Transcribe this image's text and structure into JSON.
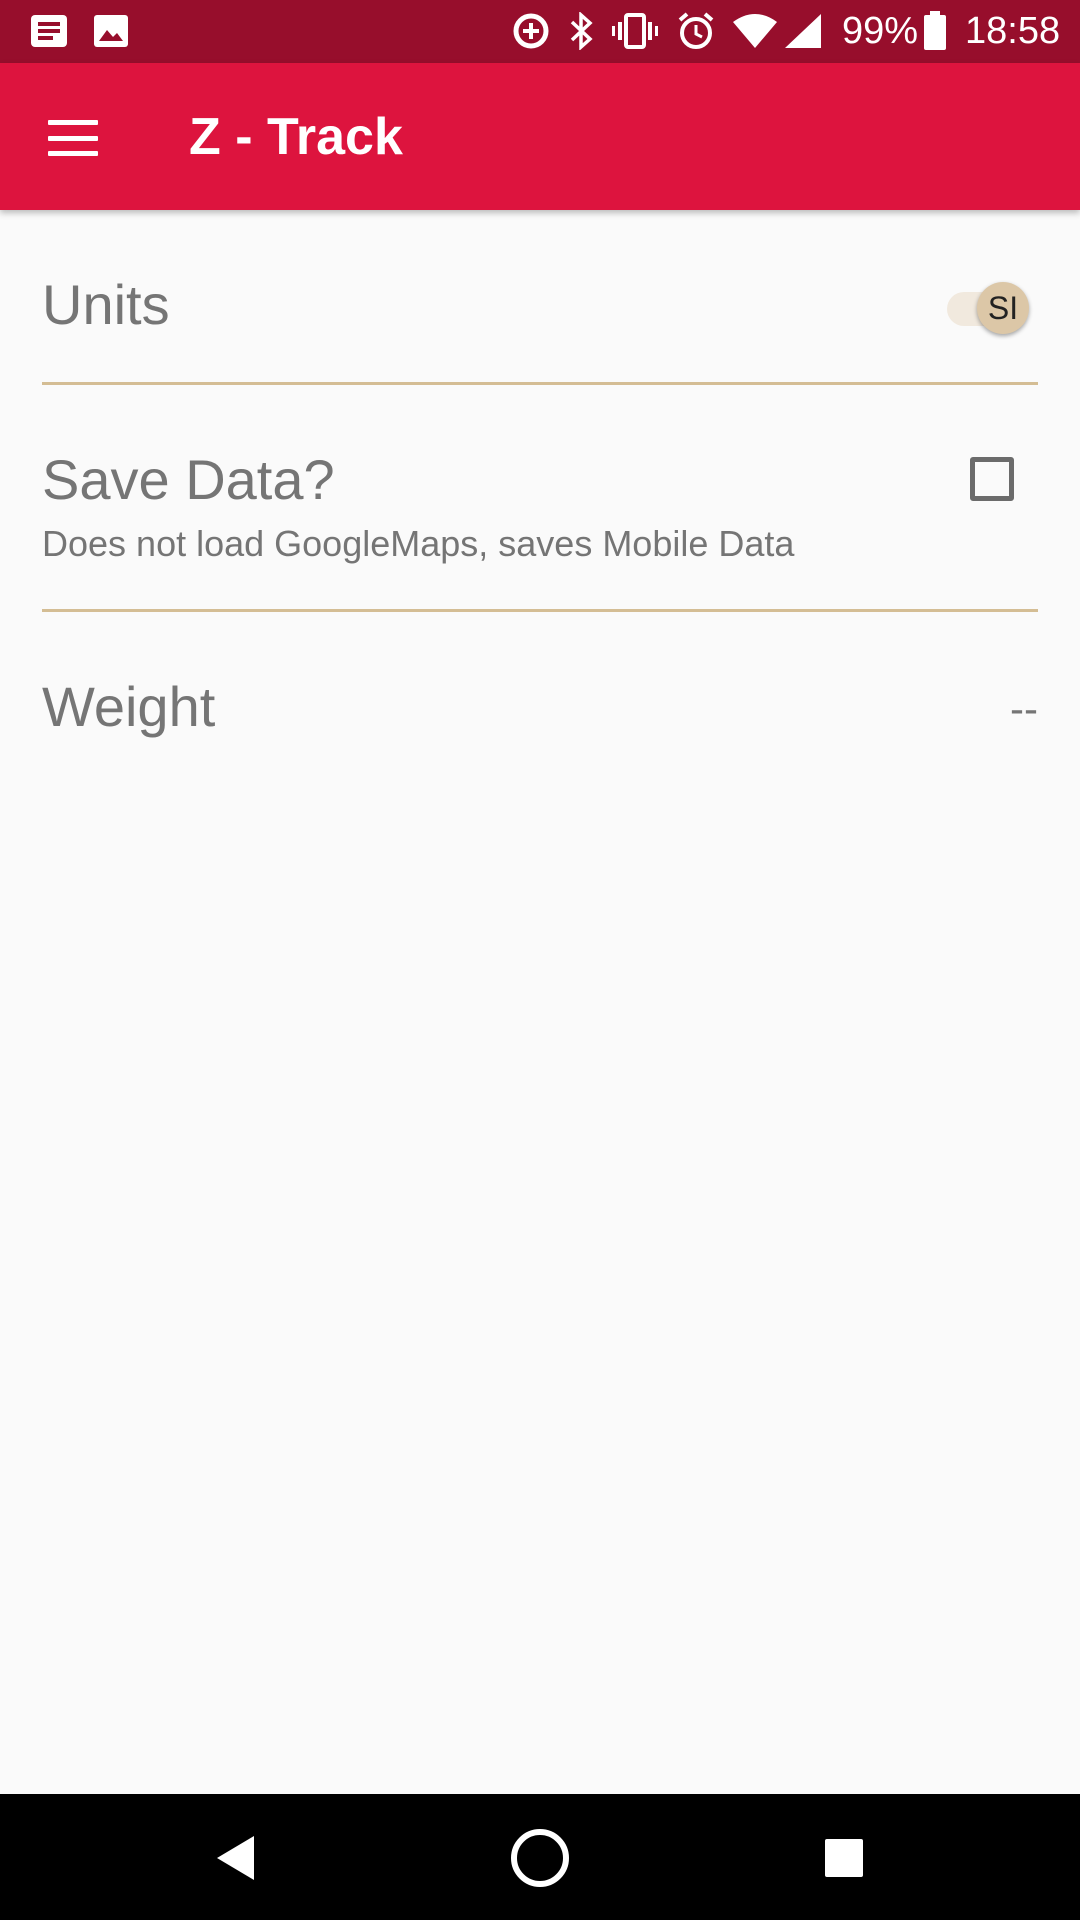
{
  "status_bar": {
    "battery_percent": "99%",
    "time": "18:58",
    "icons": [
      "notification-news-icon",
      "notification-image-icon",
      "data-saver-icon",
      "bluetooth-icon",
      "vibrate-icon",
      "alarm-icon",
      "wifi-icon",
      "cellular-signal-icon",
      "battery-icon"
    ]
  },
  "app_bar": {
    "title": "Z - Track",
    "menu_icon": "hamburger-menu-icon"
  },
  "preferences": {
    "units": {
      "title": "Units",
      "switch_label": "SI",
      "state": "on"
    },
    "save_data": {
      "title": "Save Data?",
      "summary": "Does not load GoogleMaps, saves Mobile Data",
      "checked": false
    },
    "weight": {
      "title": "Weight",
      "value": "--"
    }
  },
  "nav_bar": {
    "icons": [
      "back-icon",
      "home-icon",
      "recents-icon"
    ]
  },
  "colors": {
    "status_bar": "#970e2c",
    "app_bar": "#dd143e",
    "divider": "#d4bd94",
    "background": "#fafafa"
  }
}
